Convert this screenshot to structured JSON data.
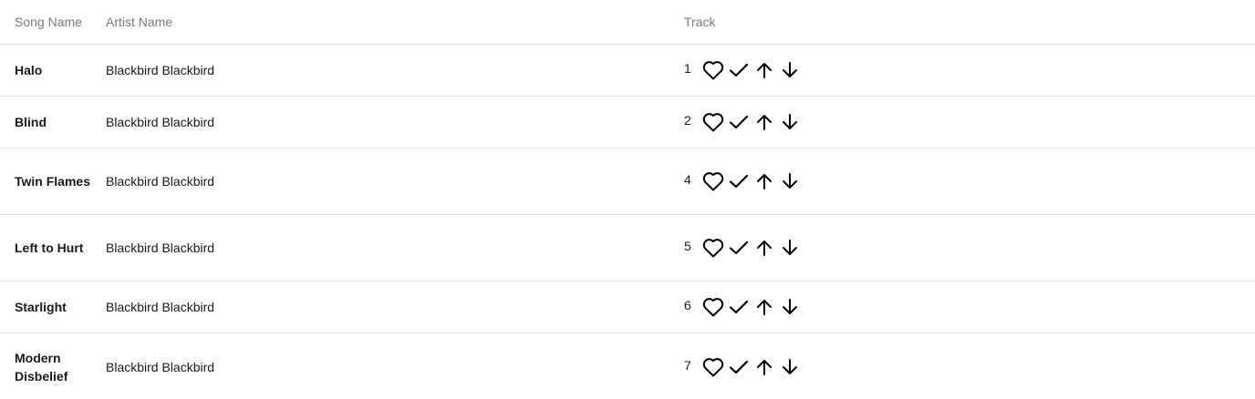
{
  "columns": {
    "song": "Song Name",
    "artist": "Artist Name",
    "track": "Track"
  },
  "rows": [
    {
      "song": "Halo",
      "artist": "Blackbird Blackbird",
      "track": "1"
    },
    {
      "song": "Blind",
      "artist": "Blackbird Blackbird",
      "track": "2"
    },
    {
      "song": "Twin Flames",
      "artist": "Blackbird Blackbird",
      "track": "4"
    },
    {
      "song": "Left to Hurt",
      "artist": "Blackbird Blackbird",
      "track": "5"
    },
    {
      "song": "Starlight",
      "artist": "Blackbird Blackbird",
      "track": "6"
    },
    {
      "song": "Modern Disbelief",
      "artist": "Blackbird Blackbird",
      "track": "7"
    }
  ],
  "row_actions": [
    "heart-icon",
    "check-icon",
    "arrow-up-icon",
    "arrow-down-icon"
  ],
  "colors": {
    "header_text": "#7a7a7a",
    "body_text": "#1a1a1a",
    "divider": "#e3e3e3"
  }
}
